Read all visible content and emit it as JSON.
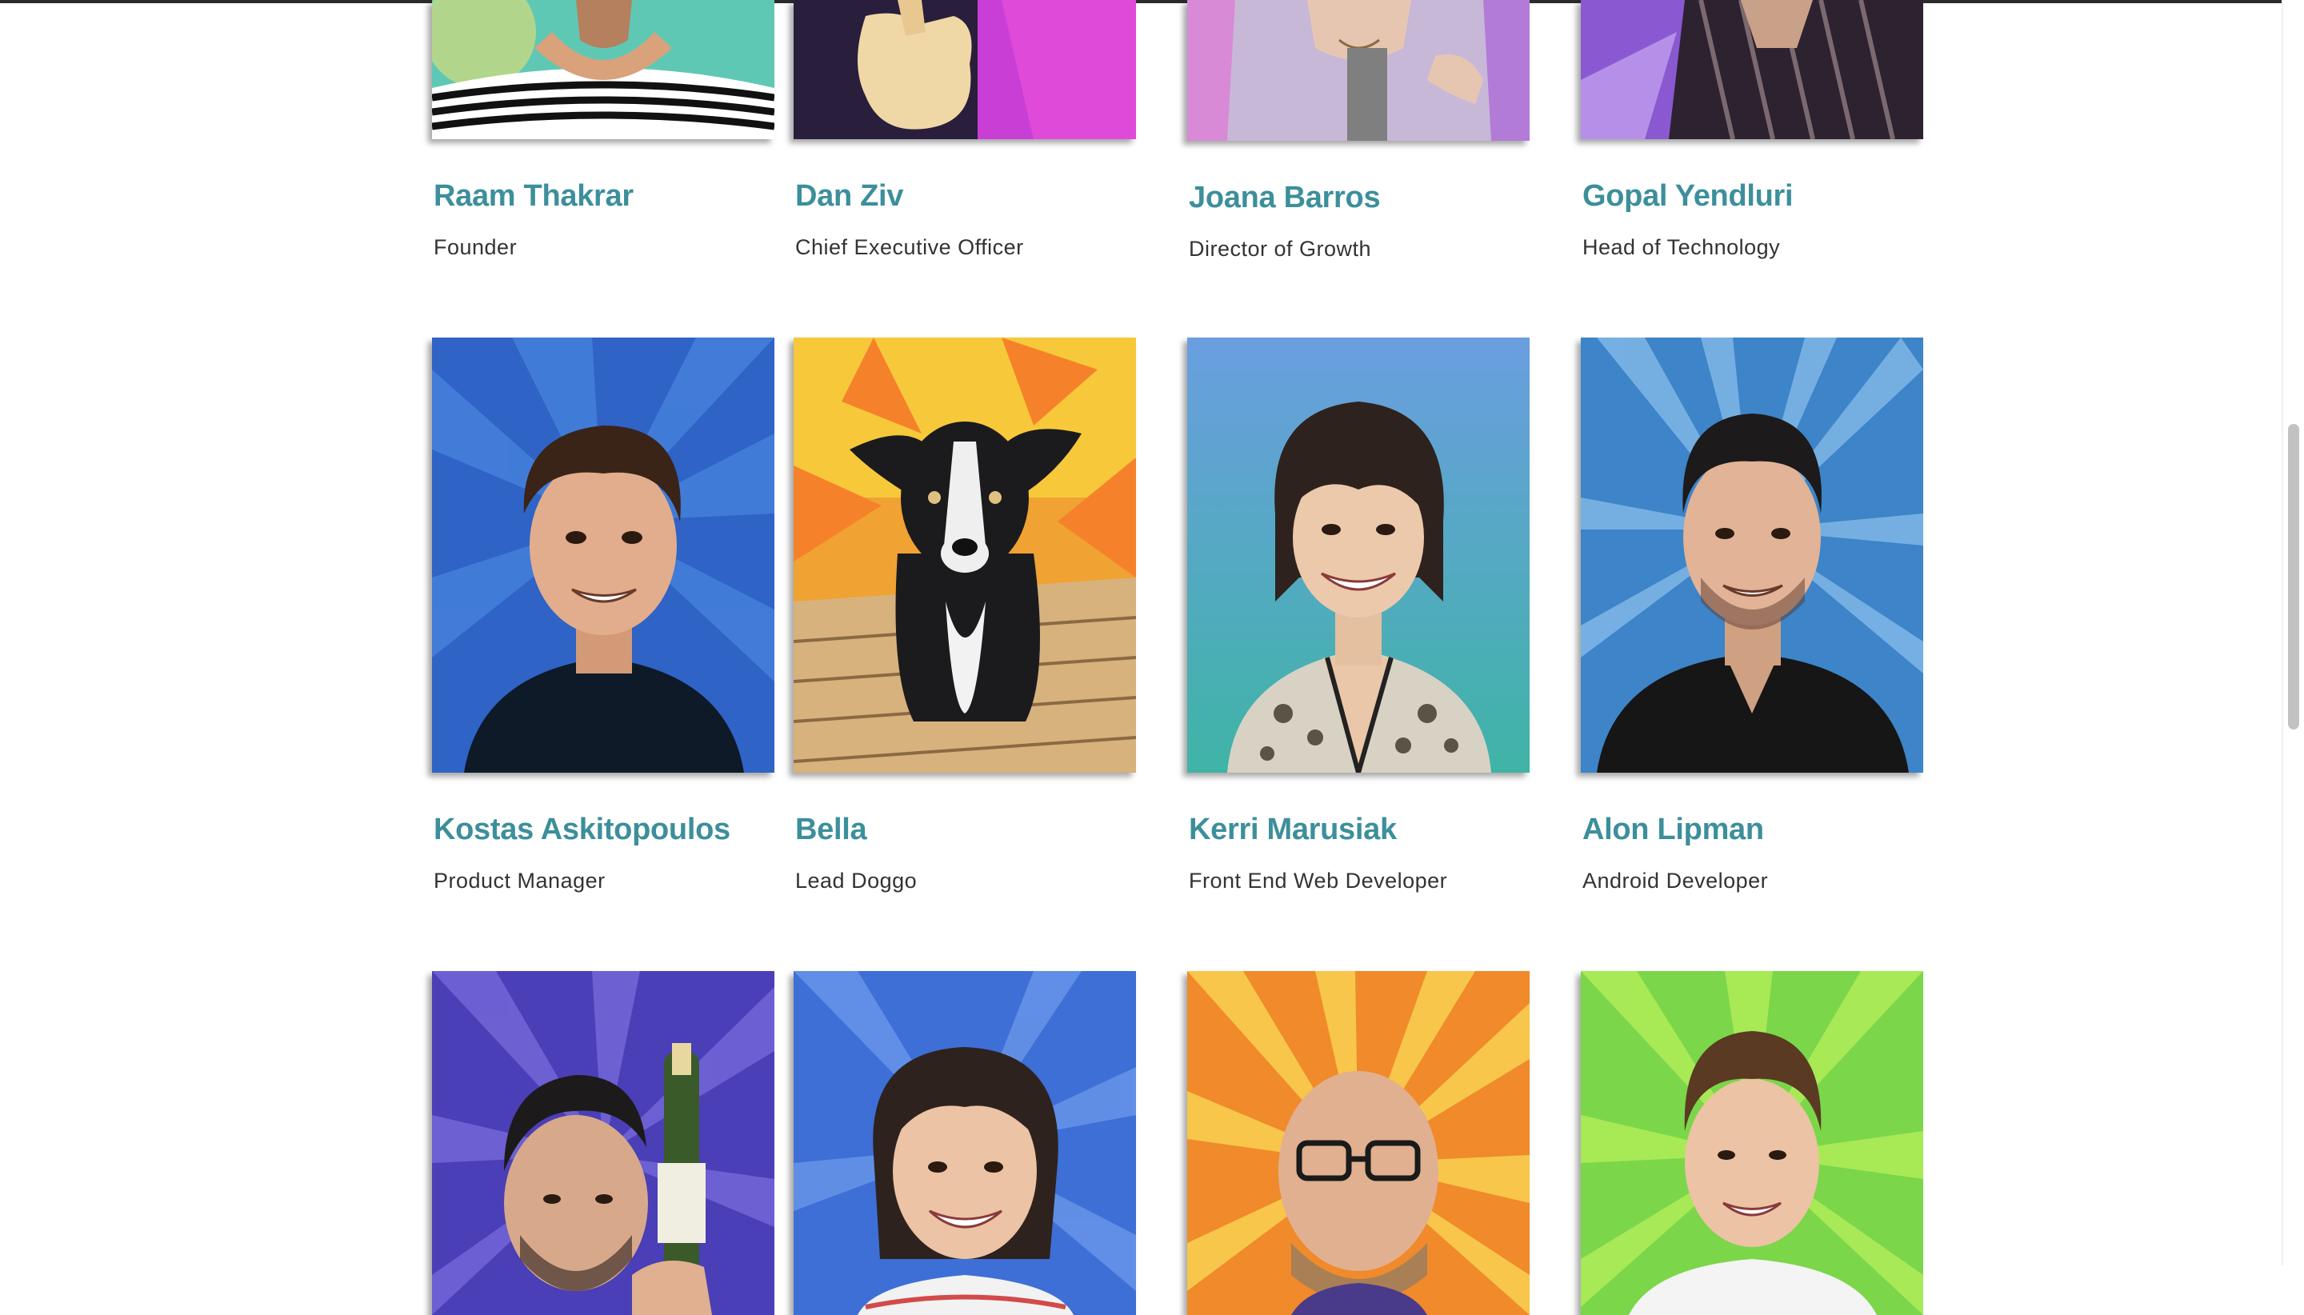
{
  "team": {
    "row1": [
      {
        "name": "Raam Thakrar",
        "role": "Founder"
      },
      {
        "name": "Dan Ziv",
        "role": "Chief Executive Officer"
      },
      {
        "name": "Joana Barros",
        "role": "Director of Growth"
      },
      {
        "name": "Gopal Yendluri",
        "role": "Head of Technology"
      }
    ],
    "row2": [
      {
        "name": "Kostas Askitopoulos",
        "role": "Product Manager"
      },
      {
        "name": "Bella",
        "role": "Lead Doggo"
      },
      {
        "name": "Kerri Marusiak",
        "role": "Front End Web Developer"
      },
      {
        "name": "Alon Lipman",
        "role": "Android Developer"
      }
    ],
    "row3_photo_count": 4
  },
  "colors": {
    "name_text": "#3c8f9b",
    "role_text": "#333333",
    "photo_bg_row1": [
      "#5fc8b5",
      "#c93fd6",
      "#b37bd8",
      "#8a58d0"
    ],
    "photo_bg_row2": [
      "#2f63c6",
      "#f0a233",
      "#6aa0d9",
      "#3d84c8"
    ],
    "photo_bg_row3": [
      "#4a3fb6",
      "#3d6fd6",
      "#f08a2a",
      "#7bd64a"
    ]
  },
  "icons": {
    "row1": [
      "portrait-striped-shirt",
      "portrait-thumbs-up",
      "portrait-necklace",
      "portrait-plaid-shirt"
    ],
    "row2": [
      "portrait-man-curly-hair",
      "portrait-dog",
      "portrait-woman-bangs",
      "portrait-man-dark-hair"
    ],
    "row3": [
      "portrait-man-champagne",
      "portrait-woman-smiling",
      "portrait-man-glasses",
      "portrait-man-smiling"
    ]
  }
}
